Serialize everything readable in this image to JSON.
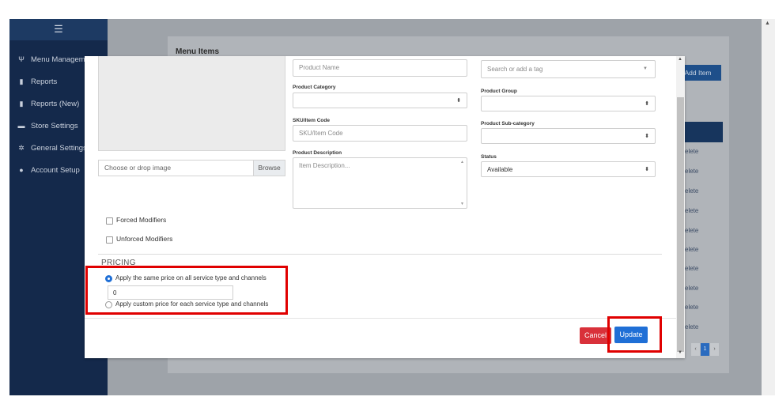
{
  "sidebar": {
    "items": [
      {
        "icon": "fork-knife-icon",
        "label": "Menu Management"
      },
      {
        "icon": "document-icon",
        "label": "Reports"
      },
      {
        "icon": "document-icon",
        "label": "Reports (New)"
      },
      {
        "icon": "store-icon",
        "label": "Store Settings"
      },
      {
        "icon": "gear-icon",
        "label": "General Settings"
      },
      {
        "icon": "user-icon",
        "label": "Account Setup"
      }
    ]
  },
  "background": {
    "title": "Menu Items",
    "add_button": "Add Item",
    "row_action": "elete",
    "pager_prev": "‹",
    "pager_page": "1",
    "pager_next": "›"
  },
  "form": {
    "product_name_placeholder": "Product Name",
    "tag_placeholder": "Search or add a tag",
    "product_category_label": "Product Category",
    "product_group_label": "Product Group",
    "sku_label": "SKU/Item Code",
    "sku_placeholder": "SKU/Item Code",
    "product_subcategory_label": "Product Sub-category",
    "product_description_label": "Product Description",
    "description_placeholder": "Item Description...",
    "status_label": "Status",
    "status_value": "Available",
    "image_placeholder": "Choose or drop image",
    "browse_label": "Browse"
  },
  "modifiers": {
    "forced": "Forced Modifiers",
    "unforced": "Unforced Modifiers"
  },
  "pricing": {
    "title": "PRICING",
    "same_price_label": "Apply the same price on all service type and channels",
    "price_value": "0",
    "custom_price_label": "Apply custom price for each service type and channels",
    "selected": "same"
  },
  "actions": {
    "cancel": "Cancel",
    "update": "Update"
  },
  "colors": {
    "sidebar": "#14294b",
    "primary": "#1f6fd6",
    "danger": "#d9313a",
    "highlight": "#e00000"
  }
}
